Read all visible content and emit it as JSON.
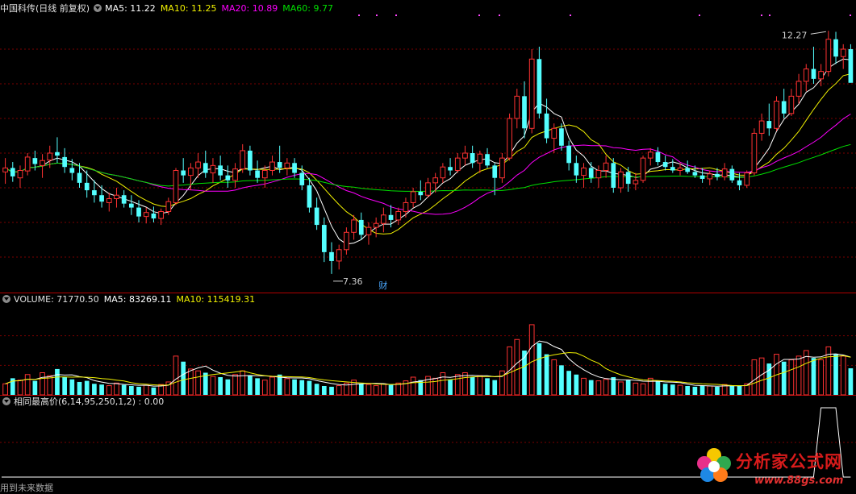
{
  "header": {
    "title": "中国科传(日线 前复权)",
    "ma_entries": [
      {
        "label": "MA5: 11.22",
        "color": "#ffffff"
      },
      {
        "label": "MA10: 11.25",
        "color": "#f0f000"
      },
      {
        "label": "MA20: 10.89",
        "color": "#ff00ff"
      },
      {
        "label": "MA60: 9.77",
        "color": "#00e000"
      }
    ]
  },
  "volume_header": {
    "title": "VOLUME: 71770.50",
    "ma_entries": [
      {
        "label": "MA5: 83269.11",
        "color": "#ffffff"
      },
      {
        "label": "MA10: 115419.31",
        "color": "#f0f000"
      }
    ]
  },
  "indicator_header": {
    "title": "相同最高价(6,14,95,250,1,2) : 0.00"
  },
  "annotations": {
    "high_label": "12.27",
    "low_label": "7.36",
    "event_marker": "财"
  },
  "footer": {
    "text": "用到未来数据"
  },
  "watermark": {
    "title": "分析家公式网",
    "url": "www.88gs.com"
  },
  "colors": {
    "up": "#ff3232",
    "down": "#54ffff",
    "grid": "#7a0000",
    "border": "#b00000",
    "ma5": "#ffffff",
    "ma10": "#f0f000",
    "ma20": "#ff00ff",
    "ma60": "#00e000"
  },
  "chart_data": {
    "type": "candlestick",
    "ylim": [
      7.0,
      12.6
    ],
    "candles": [
      [
        9.42,
        9.7,
        9.18,
        9.5
      ],
      [
        9.5,
        9.62,
        9.22,
        9.33
      ],
      [
        9.3,
        9.55,
        9.1,
        9.45
      ],
      [
        9.44,
        9.8,
        9.35,
        9.72
      ],
      [
        9.7,
        9.85,
        9.45,
        9.58
      ],
      [
        9.55,
        9.78,
        9.3,
        9.65
      ],
      [
        9.66,
        9.95,
        9.5,
        9.8
      ],
      [
        9.82,
        10.12,
        9.6,
        9.75
      ],
      [
        9.72,
        9.9,
        9.4,
        9.52
      ],
      [
        9.5,
        9.68,
        9.25,
        9.4
      ],
      [
        9.4,
        9.6,
        9.1,
        9.2
      ],
      [
        9.2,
        9.45,
        8.9,
        9.05
      ],
      [
        9.05,
        9.25,
        8.8,
        8.95
      ],
      [
        8.95,
        9.15,
        8.7,
        8.82
      ],
      [
        8.8,
        9.0,
        8.62,
        8.88
      ],
      [
        8.88,
        9.1,
        8.7,
        8.95
      ],
      [
        8.95,
        9.05,
        8.7,
        8.78
      ],
      [
        8.78,
        8.95,
        8.55,
        8.7
      ],
      [
        8.7,
        8.85,
        8.4,
        8.52
      ],
      [
        8.52,
        8.7,
        8.38,
        8.6
      ],
      [
        8.58,
        8.72,
        8.4,
        8.48
      ],
      [
        8.48,
        8.68,
        8.35,
        8.62
      ],
      [
        8.62,
        8.9,
        8.55,
        8.82
      ],
      [
        8.8,
        9.5,
        8.75,
        9.45
      ],
      [
        9.45,
        9.7,
        9.2,
        9.35
      ],
      [
        9.35,
        9.6,
        9.05,
        9.5
      ],
      [
        9.5,
        9.8,
        9.3,
        9.62
      ],
      [
        9.6,
        9.85,
        9.3,
        9.4
      ],
      [
        9.4,
        9.7,
        9.2,
        9.55
      ],
      [
        9.55,
        9.75,
        9.25,
        9.35
      ],
      [
        9.35,
        9.55,
        9.1,
        9.25
      ],
      [
        9.25,
        9.6,
        9.1,
        9.48
      ],
      [
        9.48,
        9.98,
        9.4,
        9.85
      ],
      [
        9.85,
        9.95,
        9.35,
        9.45
      ],
      [
        9.45,
        9.65,
        9.2,
        9.3
      ],
      [
        9.3,
        9.55,
        9.1,
        9.45
      ],
      [
        9.45,
        9.75,
        9.35,
        9.62
      ],
      [
        9.62,
        9.95,
        9.4,
        9.5
      ],
      [
        9.5,
        9.7,
        9.35,
        9.6
      ],
      [
        9.6,
        9.7,
        9.3,
        9.4
      ],
      [
        9.4,
        9.55,
        9.05,
        9.15
      ],
      [
        9.15,
        9.3,
        8.6,
        8.7
      ],
      [
        8.7,
        8.9,
        8.25,
        8.35
      ],
      [
        8.35,
        8.5,
        7.6,
        7.8
      ],
      [
        7.8,
        8.0,
        7.36,
        7.62
      ],
      [
        7.62,
        7.95,
        7.45,
        7.85
      ],
      [
        7.85,
        8.3,
        7.75,
        8.2
      ],
      [
        8.2,
        8.55,
        8.05,
        8.45
      ],
      [
        8.45,
        8.6,
        8.05,
        8.15
      ],
      [
        8.15,
        8.4,
        7.95,
        8.3
      ],
      [
        8.3,
        8.5,
        8.1,
        8.38
      ],
      [
        8.38,
        8.7,
        8.2,
        8.55
      ],
      [
        8.55,
        8.75,
        8.3,
        8.45
      ],
      [
        8.45,
        8.7,
        8.35,
        8.62
      ],
      [
        8.62,
        8.9,
        8.5,
        8.8
      ],
      [
        8.8,
        9.1,
        8.7,
        9.02
      ],
      [
        9.02,
        9.25,
        8.85,
        8.95
      ],
      [
        8.95,
        9.3,
        8.9,
        9.2
      ],
      [
        9.2,
        9.4,
        9.0,
        9.3
      ],
      [
        9.3,
        9.6,
        9.2,
        9.52
      ],
      [
        9.52,
        9.7,
        9.35,
        9.45
      ],
      [
        9.45,
        9.8,
        9.4,
        9.7
      ],
      [
        9.7,
        9.95,
        9.55,
        9.8
      ],
      [
        9.8,
        9.95,
        9.5,
        9.6
      ],
      [
        9.6,
        9.85,
        9.4,
        9.78
      ],
      [
        9.78,
        9.9,
        9.5,
        9.55
      ],
      [
        9.55,
        9.6,
        8.95,
        9.3
      ],
      [
        9.3,
        9.8,
        9.2,
        9.7
      ],
      [
        9.7,
        10.6,
        9.65,
        10.5
      ],
      [
        10.5,
        11.1,
        10.3,
        10.95
      ],
      [
        10.95,
        11.25,
        10.1,
        10.3
      ],
      [
        10.3,
        11.9,
        10.2,
        11.7
      ],
      [
        11.7,
        11.95,
        10.5,
        10.6
      ],
      [
        10.6,
        10.9,
        10.0,
        10.1
      ],
      [
        10.1,
        10.4,
        9.8,
        10.3
      ],
      [
        10.3,
        10.4,
        9.85,
        9.95
      ],
      [
        9.95,
        10.05,
        9.45,
        9.6
      ],
      [
        9.6,
        9.75,
        9.2,
        9.35
      ],
      [
        9.35,
        9.6,
        9.1,
        9.5
      ],
      [
        9.5,
        9.62,
        9.2,
        9.3
      ],
      [
        9.3,
        9.55,
        9.1,
        9.45
      ],
      [
        9.45,
        9.75,
        9.3,
        9.6
      ],
      [
        9.6,
        9.7,
        9.0,
        9.1
      ],
      [
        9.1,
        9.5,
        9.0,
        9.42
      ],
      [
        9.42,
        9.52,
        9.02,
        9.18
      ],
      [
        9.18,
        9.4,
        9.05,
        9.25
      ],
      [
        9.25,
        9.75,
        9.2,
        9.7
      ],
      [
        9.7,
        9.9,
        9.55,
        9.82
      ],
      [
        9.82,
        9.92,
        9.55,
        9.62
      ],
      [
        9.62,
        9.75,
        9.45,
        9.52
      ],
      [
        9.52,
        9.68,
        9.4,
        9.45
      ],
      [
        9.45,
        9.6,
        9.35,
        9.5
      ],
      [
        9.5,
        9.65,
        9.38,
        9.42
      ],
      [
        9.42,
        9.55,
        9.3,
        9.35
      ],
      [
        9.35,
        9.5,
        9.2,
        9.28
      ],
      [
        9.28,
        9.45,
        9.15,
        9.38
      ],
      [
        9.38,
        9.5,
        9.25,
        9.32
      ],
      [
        9.32,
        9.6,
        9.25,
        9.48
      ],
      [
        9.48,
        9.55,
        9.2,
        9.25
      ],
      [
        9.25,
        9.4,
        9.05,
        9.15
      ],
      [
        9.15,
        9.45,
        9.1,
        9.4
      ],
      [
        9.4,
        10.3,
        9.35,
        10.2
      ],
      [
        10.2,
        10.6,
        10.05,
        10.45
      ],
      [
        10.45,
        10.8,
        10.15,
        10.3
      ],
      [
        10.3,
        10.95,
        10.25,
        10.85
      ],
      [
        10.85,
        11.1,
        10.5,
        10.6
      ],
      [
        10.6,
        11.1,
        10.55,
        10.95
      ],
      [
        10.95,
        11.4,
        10.8,
        11.25
      ],
      [
        11.25,
        11.6,
        11.05,
        11.5
      ],
      [
        11.5,
        11.95,
        11.2,
        11.3
      ],
      [
        11.3,
        11.6,
        11.15,
        11.45
      ],
      [
        11.45,
        12.27,
        11.35,
        12.1
      ],
      [
        12.1,
        12.25,
        11.6,
        11.75
      ],
      [
        11.75,
        12.0,
        11.5,
        11.9
      ],
      [
        11.9,
        12.0,
        11.3,
        11.22
      ]
    ],
    "volume_panel": {
      "title": "VOLUME",
      "ylim": [
        0,
        240000
      ],
      "volumes": [
        30000,
        45000,
        40000,
        55000,
        38000,
        60000,
        52000,
        70000,
        48000,
        42000,
        35000,
        38000,
        30000,
        28000,
        25000,
        32000,
        27000,
        24000,
        22000,
        26000,
        20000,
        28000,
        35000,
        105000,
        90000,
        70000,
        65000,
        60000,
        50000,
        48000,
        42000,
        55000,
        65000,
        52000,
        45000,
        40000,
        48000,
        55000,
        44000,
        42000,
        40000,
        38000,
        30000,
        24000,
        22000,
        25000,
        32000,
        40000,
        30000,
        28000,
        25000,
        30000,
        27000,
        32000,
        38000,
        48000,
        40000,
        50000,
        45000,
        60000,
        42000,
        55000,
        60000,
        48000,
        52000,
        45000,
        40000,
        65000,
        130000,
        150000,
        120000,
        190000,
        140000,
        110000,
        95000,
        80000,
        65000,
        55000,
        45000,
        40000,
        38000,
        42000,
        48000,
        35000,
        40000,
        32000,
        30000,
        45000,
        38000,
        30000,
        28000,
        26000,
        24000,
        22000,
        25000,
        24000,
        22000,
        28000,
        24000,
        25000,
        30000,
        95000,
        100000,
        85000,
        110000,
        90000,
        95000,
        105000,
        120000,
        100000,
        95000,
        130000,
        110000,
        105000,
        72000
      ]
    },
    "indicator_panel": {
      "title": "相同最高价",
      "ylim": [
        0,
        1
      ],
      "values_nonzero": [
        [
          110,
          1
        ],
        [
          111,
          1
        ],
        [
          112,
          1
        ]
      ]
    }
  }
}
